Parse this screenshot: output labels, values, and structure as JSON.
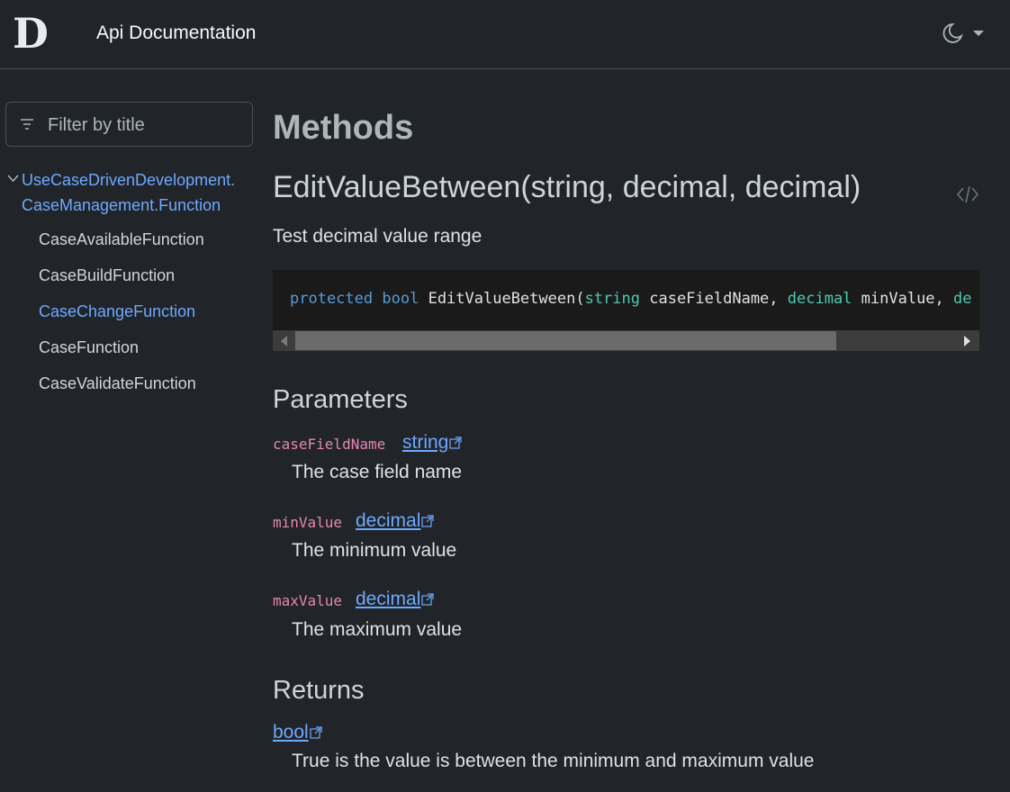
{
  "header": {
    "logo_letter": "D",
    "title": "Api Documentation",
    "theme_icon": "moon-icon"
  },
  "sidebar": {
    "filter_placeholder": "Filter by title",
    "root": {
      "label": "UseCaseDrivenDevelopment.\nCaseManagement.Function",
      "expanded": true
    },
    "items": [
      {
        "label": "CaseAvailableFunction",
        "active": false
      },
      {
        "label": "CaseBuildFunction",
        "active": false
      },
      {
        "label": "CaseChangeFunction",
        "active": true
      },
      {
        "label": "CaseFunction",
        "active": false
      },
      {
        "label": "CaseValidateFunction",
        "active": false
      }
    ]
  },
  "main": {
    "section_title": "Methods",
    "method_title": "EditValueBetween(string, decimal, decimal)",
    "summary": "Test decimal value range",
    "code": {
      "modifier": "protected",
      "return_type": "bool",
      "name": "EditValueBetween(",
      "param1_type": "string",
      "param1_name": " caseFieldName, ",
      "param2_type": "decimal",
      "param2_name": " minValue, ",
      "param3_type_visible": "de"
    },
    "parameters_heading": "Parameters",
    "parameters": [
      {
        "name": "caseFieldName",
        "type": "string",
        "description": "The case field name"
      },
      {
        "name": "minValue",
        "type": "decimal",
        "description": "The minimum value"
      },
      {
        "name": "maxValue",
        "type": "decimal",
        "description": "The maximum value"
      }
    ],
    "returns_heading": "Returns",
    "returns": {
      "type": "bool",
      "description": "True is the value is between the minimum and maximum value"
    }
  },
  "colors": {
    "background": "#212529",
    "link": "#6ea8fe",
    "param_name": "#e685b5",
    "keyword": "#569cd6",
    "type": "#4ec9b0"
  }
}
